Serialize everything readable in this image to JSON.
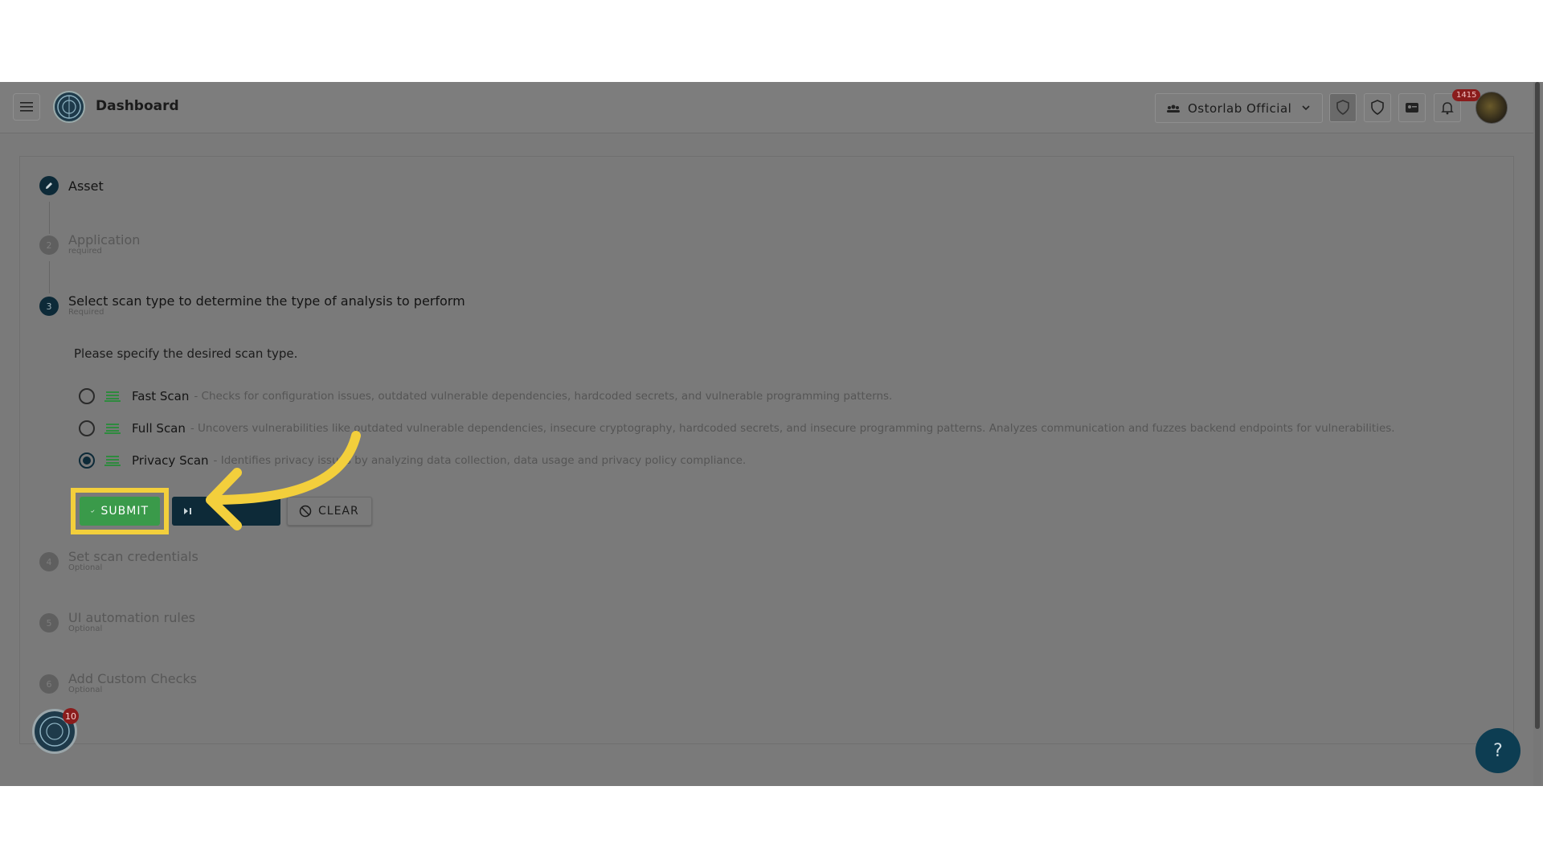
{
  "header": {
    "title": "Dashboard",
    "org_name": "Ostorlab Official",
    "notification_count": "1415"
  },
  "steps": [
    {
      "number": "",
      "title": "Asset",
      "subtitle": "",
      "state": "done"
    },
    {
      "number": "2",
      "title": "Application",
      "subtitle": "required",
      "state": "pending"
    },
    {
      "number": "3",
      "title": "Select scan type to determine the type of analysis to perform",
      "subtitle": "Required",
      "state": "current"
    },
    {
      "number": "4",
      "title": "Set scan credentials",
      "subtitle": "Optional",
      "state": "pending"
    },
    {
      "number": "5",
      "title": "UI automation rules",
      "subtitle": "Optional",
      "state": "pending"
    },
    {
      "number": "6",
      "title": "Add Custom Checks",
      "subtitle": "Optional",
      "state": "pending"
    }
  ],
  "scan_type": {
    "prompt": "Please specify the desired scan type.",
    "options": [
      {
        "name": "Fast Scan",
        "desc": "- Checks for configuration issues, outdated vulnerable dependencies, hardcoded secrets, and vulnerable programming patterns.",
        "selected": false
      },
      {
        "name": "Full Scan",
        "desc": "- Uncovers vulnerabilities like outdated vulnerable dependencies, insecure cryptography, hardcoded secrets, and insecure programming patterns. Analyzes communication and fuzzes backend endpoints for vulnerabilities.",
        "selected": false
      },
      {
        "name": "Privacy Scan",
        "desc": "- Identifies privacy issues by analyzing data collection, data usage and privacy policy compliance.",
        "selected": true
      }
    ]
  },
  "actions": {
    "submit_label": "SUBMIT",
    "clear_label": "CLEAR"
  },
  "bot_badge": "10",
  "help_label": "?",
  "colors": {
    "submit": "#3a9a4a",
    "primary": "#0d2a38",
    "highlight": "#f3cf3c",
    "badge": "#8a1c1c"
  }
}
